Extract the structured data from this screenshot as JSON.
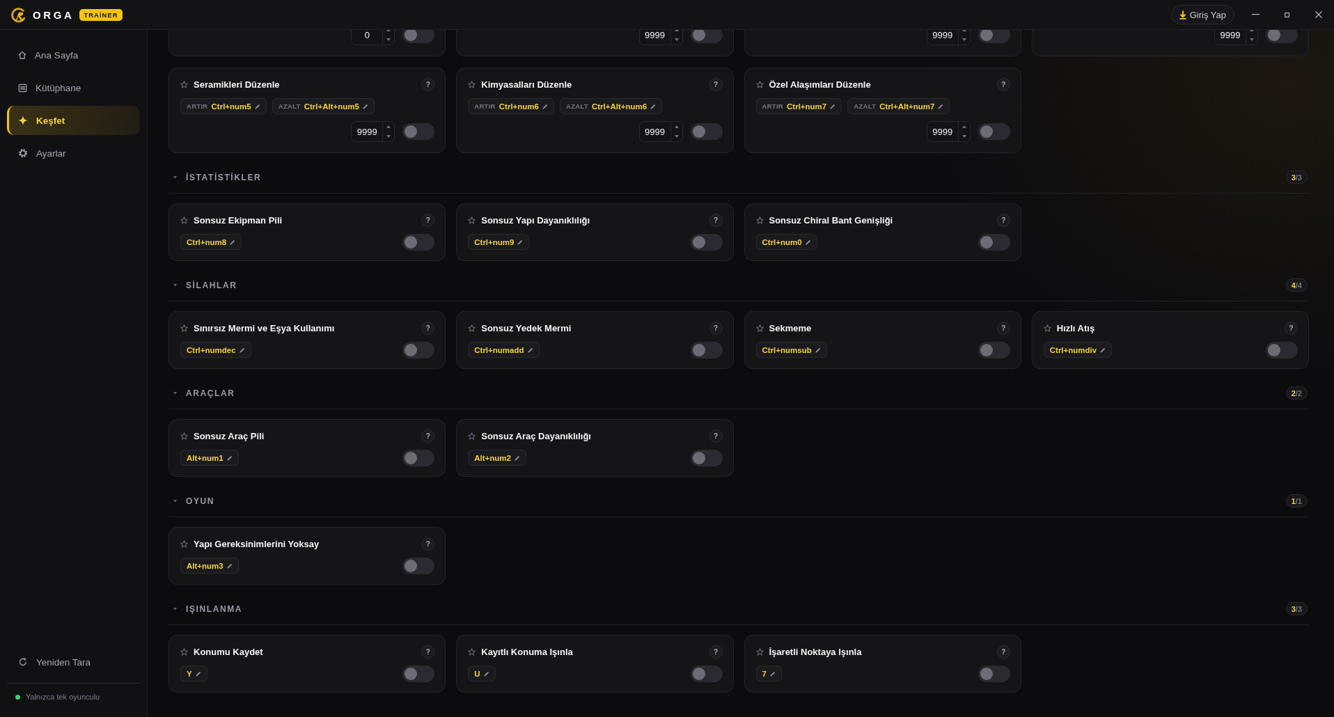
{
  "titlebar": {
    "brand": "ORGA",
    "badge": "TRAİNER",
    "login": "Giriş Yap"
  },
  "sidebar": {
    "items": [
      {
        "kind": "home",
        "label": "Ana Sayfa",
        "selected": false
      },
      {
        "kind": "library",
        "label": "Kütüphane",
        "selected": false
      },
      {
        "kind": "discover",
        "label": "Keşfet",
        "selected": true
      },
      {
        "kind": "settings",
        "label": "Ayarlar",
        "selected": false
      }
    ],
    "rescan": "Yeniden Tara",
    "status": {
      "label": "Yalnızca tek oyunculu",
      "online": true
    }
  },
  "sections": [
    {
      "cards": [
        {
          "kind": "value",
          "value": "0",
          "on": false
        },
        {
          "kind": "value",
          "value": "9999",
          "on": false
        },
        {
          "kind": "value",
          "value": "9999",
          "on": false
        },
        {
          "kind": "value",
          "value": "9999",
          "on": false
        },
        {
          "kind": "value",
          "title": "Seramikleri Düzenle",
          "favorite": false,
          "help": "?",
          "hotkeys": [
            {
              "label": "ARTIR",
              "keys": "Ctrl+num5"
            },
            {
              "label": "AZALT",
              "keys": "Ctrl+Alt+num5"
            }
          ],
          "value": "9999",
          "on": false
        },
        {
          "kind": "value",
          "title": "Kimyasalları Düzenle",
          "favorite": false,
          "help": "?",
          "hotkeys": [
            {
              "label": "ARTIR",
              "keys": "Ctrl+num6"
            },
            {
              "label": "AZALT",
              "keys": "Ctrl+Alt+num6"
            }
          ],
          "value": "9999",
          "on": false
        },
        {
          "kind": "value",
          "title": "Özel Alaşımları Düzenle",
          "favorite": false,
          "help": "?",
          "hotkeys": [
            {
              "label": "ARTIR",
              "keys": "Ctrl+num7"
            },
            {
              "label": "AZALT",
              "keys": "Ctrl+Alt+num7"
            }
          ],
          "value": "9999",
          "on": false
        }
      ]
    },
    {
      "title": "İSTATİSTİKLER",
      "count": "3/3",
      "expanded": true,
      "cards": [
        {
          "kind": "toggle",
          "title": "Sonsuz Ekipman Pili",
          "favorite": false,
          "help": "?",
          "hotkeys": [
            {
              "keys": "Ctrl+num8"
            }
          ],
          "on": false
        },
        {
          "kind": "toggle",
          "title": "Sonsuz Yapı Dayanıklılığı",
          "favorite": false,
          "help": "?",
          "hotkeys": [
            {
              "keys": "Ctrl+num9"
            }
          ],
          "on": false
        },
        {
          "kind": "toggle",
          "title": "Sonsuz Chiral Bant Genişliği",
          "favorite": false,
          "help": "?",
          "hotkeys": [
            {
              "keys": "Ctrl+num0"
            }
          ],
          "on": false
        }
      ]
    },
    {
      "title": "SİLAHLAR",
      "count": "4/4",
      "expanded": true,
      "cards": [
        {
          "kind": "toggle",
          "title": "Sınırsız Mermi ve Eşya Kullanımı",
          "favorite": false,
          "help": "?",
          "hotkeys": [
            {
              "keys": "Ctrl+numdec"
            }
          ],
          "on": false
        },
        {
          "kind": "toggle",
          "title": "Sonsuz Yedek Mermi",
          "favorite": false,
          "help": "?",
          "hotkeys": [
            {
              "keys": "Ctrl+numadd"
            }
          ],
          "on": false
        },
        {
          "kind": "toggle",
          "title": "Sekmeme",
          "favorite": false,
          "help": "?",
          "hotkeys": [
            {
              "keys": "Ctrl+numsub"
            }
          ],
          "on": false
        },
        {
          "kind": "toggle",
          "title": "Hızlı Atış",
          "favorite": false,
          "help": "?",
          "hotkeys": [
            {
              "keys": "Ctrl+numdiv"
            }
          ],
          "on": false
        }
      ]
    },
    {
      "title": "ARAÇLAR",
      "count": "2/2",
      "expanded": true,
      "cards": [
        {
          "kind": "toggle",
          "title": "Sonsuz Araç Pili",
          "favorite": false,
          "help": "?",
          "hotkeys": [
            {
              "keys": "Alt+num1"
            }
          ],
          "on": false
        },
        {
          "kind": "toggle",
          "title": "Sonsuz Araç Dayanıklılığı",
          "favorite": false,
          "help": "?",
          "hotkeys": [
            {
              "keys": "Alt+num2"
            }
          ],
          "on": false
        }
      ]
    },
    {
      "title": "OYUN",
      "count": "1/1",
      "expanded": true,
      "cards": [
        {
          "kind": "toggle",
          "title": "Yapı Gereksinimlerini Yoksay",
          "favorite": false,
          "help": "?",
          "hotkeys": [
            {
              "keys": "Alt+num3"
            }
          ],
          "on": false
        }
      ]
    },
    {
      "title": "IŞINLANMA",
      "count": "3/3",
      "expanded": true,
      "cards": [
        {
          "kind": "toggle",
          "title": "Konumu Kaydet",
          "favorite": false,
          "help": "?",
          "hotkeys": [
            {
              "keys": "Y"
            }
          ],
          "on": false
        },
        {
          "kind": "toggle",
          "title": "Kayıtlı Konuma Işınla",
          "favorite": false,
          "help": "?",
          "hotkeys": [
            {
              "keys": "U"
            }
          ],
          "on": false
        },
        {
          "kind": "toggle",
          "title": "İşaretli Noktaya Işınla",
          "favorite": false,
          "help": "?",
          "hotkeys": [
            {
              "keys": "7"
            }
          ],
          "on": false
        }
      ]
    }
  ]
}
